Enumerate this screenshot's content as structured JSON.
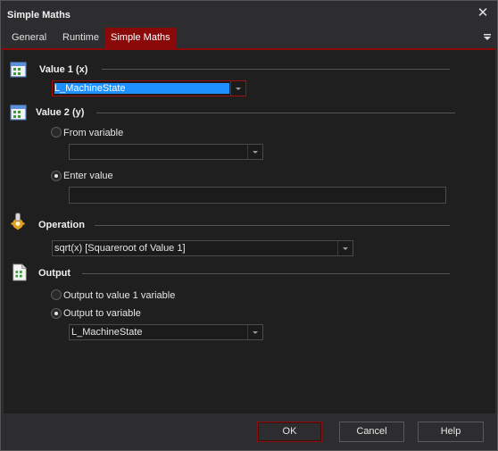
{
  "window": {
    "title": "Simple Maths"
  },
  "tabs": [
    {
      "label": "General"
    },
    {
      "label": "Runtime"
    },
    {
      "label": "Simple Maths"
    }
  ],
  "value1": {
    "heading": "Value 1 (x)",
    "variable": "L_MachineState"
  },
  "value2": {
    "heading": "Value 2 (y)",
    "from_variable_label": "From variable",
    "from_variable_value": "",
    "enter_value_label": "Enter value",
    "enter_value_value": "",
    "selected": "enter_value"
  },
  "operation": {
    "heading": "Operation",
    "selected": "sqrt(x)  [Squareroot of Value 1]"
  },
  "output": {
    "heading": "Output",
    "option1_label": "Output to value 1 variable",
    "option2_label": "Output to variable",
    "selected": "output_to_variable",
    "variable": "L_MachineState"
  },
  "buttons": {
    "ok": "OK",
    "cancel": "Cancel",
    "help": "Help"
  },
  "colors": {
    "accent": "#8a0a0a",
    "selection": "#1e90ff",
    "background": "#1f1f1f"
  },
  "icons": {
    "close": "close-icon",
    "menu": "menu-icon",
    "value1": "variable-list-icon",
    "value2": "variable-list-icon",
    "operation": "gear-icon",
    "output": "document-list-icon"
  }
}
